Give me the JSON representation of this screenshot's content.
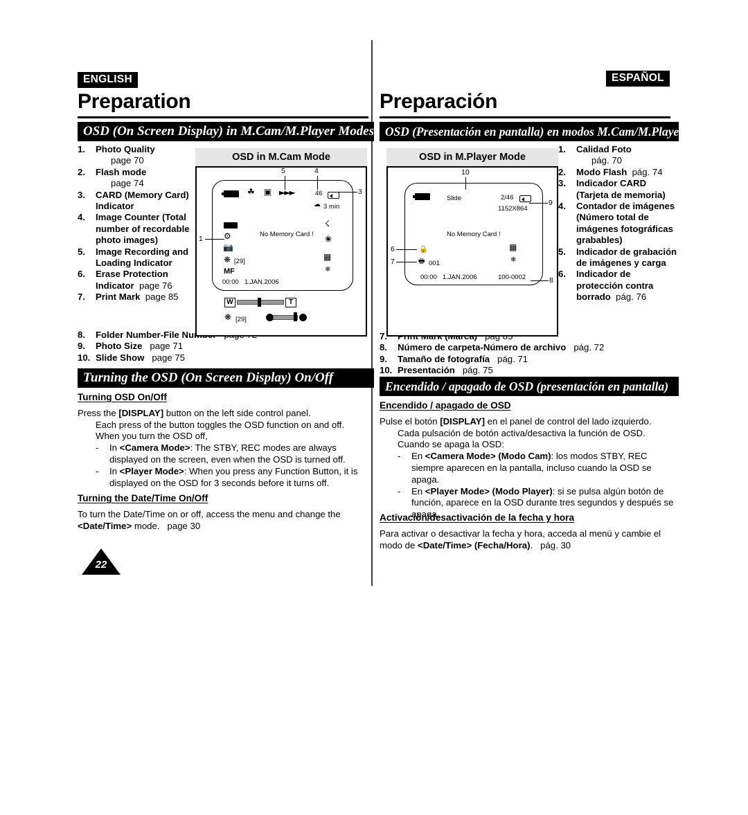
{
  "page": {
    "number": "22"
  },
  "english": {
    "lang_badge": "ENGLISH",
    "title": "Preparation",
    "section_osd_title": "OSD (On Screen Display) in M.Cam/M.Player Modes",
    "section_turn_title": "Turning the OSD (On Screen Display) On/Off",
    "list_items": [
      {
        "n": "1.",
        "label": "Photo Quality",
        "page": "page 70",
        "page_on_new_line": true
      },
      {
        "n": "2.",
        "label": "Flash mode",
        "page": "page 74",
        "page_on_new_line": true
      },
      {
        "n": "3.",
        "label": "CARD (Memory Card) Indicator",
        "page": "",
        "page_on_new_line": false
      },
      {
        "n": "4.",
        "label": "Image Counter (Total number of recordable photo images)",
        "page": "",
        "page_on_new_line": false
      },
      {
        "n": "5.",
        "label": "Image Recording and Loading Indicator",
        "page": "",
        "page_on_new_line": false
      },
      {
        "n": "6.",
        "label": "Erase Protection Indicator",
        "page": "page 76",
        "page_on_new_line": false
      },
      {
        "n": "7.",
        "label": "Print Mark",
        "page": "page 85",
        "page_on_new_line": false
      }
    ],
    "list_items_tail": [
      {
        "n": "8.",
        "label": "Folder Number-File Number",
        "page": "page 72"
      },
      {
        "n": "9.",
        "label": "Photo Size",
        "page": "page 71"
      },
      {
        "n": "10.",
        "label": "Slide Show",
        "page": "page 75"
      }
    ],
    "osd_panel_title": "OSD in M.Cam Mode",
    "sub_head_1": "Turning OSD On/Off",
    "para_1_a": "Press the ",
    "para_1_display": "[DISPLAY]",
    "para_1_b": " button on the left side control panel.",
    "para_1_ind_1": "Each press of the button toggles the OSD function on and off.",
    "para_1_ind_2": "When you turn the OSD off,",
    "bullet_1_dash": "-",
    "bullet_1_pre": "In ",
    "bullet_1_bold": "<Camera Mode>",
    "bullet_1_post": ": The STBY, REC modes are always displayed on the screen, even when the OSD is turned off.",
    "bullet_2_dash": "-",
    "bullet_2_pre": "In ",
    "bullet_2_bold": "<Player Mode>",
    "bullet_2_post": ": When you press any Function Button, it is displayed on the OSD for 3 seconds before it turns off.",
    "sub_head_2": "Turning the Date/Time On/Off",
    "para_2_a": "To turn the Date/Time on or off, access the menu and change the ",
    "para_2_bold": "<Date/Time>",
    "para_2_b": " mode.",
    "para_2_page": "page 30"
  },
  "spanish": {
    "lang_badge": "ESPAÑOL",
    "title": "Preparación",
    "section_osd_title": "OSD (Presentación en pantalla) en modos M.Cam/M.Player",
    "section_turn_title": "Encendido / apagado de OSD (presentación en pantalla)",
    "list_items": [
      {
        "n": "1.",
        "label": "Calidad Foto",
        "page": "pág. 70",
        "page_on_new_line": true
      },
      {
        "n": "2.",
        "label": "Modo Flash",
        "page": "pág. 74",
        "page_on_new_line": false
      },
      {
        "n": "3.",
        "label": "Indicador CARD (Tarjeta de memoria)",
        "page": "",
        "page_on_new_line": false
      },
      {
        "n": "4.",
        "label": "Contador de imágenes (Número total de imágenes fotográficas grabables)",
        "page": "",
        "page_on_new_line": false
      },
      {
        "n": "5.",
        "label": "Indicador de grabación de imágenes y carga",
        "page": "",
        "page_on_new_line": false
      },
      {
        "n": "6.",
        "label": "Indicador de protección contra borrado",
        "page": "pág. 76",
        "page_on_new_line": false
      }
    ],
    "list_items_tail": [
      {
        "n": "7.",
        "label": "Print Mark (Marca)",
        "page": "pág 85"
      },
      {
        "n": "8.",
        "label": "Número de carpeta-Número de archivo",
        "page": "pág. 72"
      },
      {
        "n": "9.",
        "label": "Tamaño de fotografía",
        "page": "pág. 71"
      },
      {
        "n": "10.",
        "label": "Presentación",
        "page": "pág. 75"
      }
    ],
    "osd_panel_title": "OSD in M.Player Mode",
    "sub_head_1": "Encendido / apagado de OSD",
    "para_1_a": "Pulse el botón ",
    "para_1_display": "[DISPLAY]",
    "para_1_b": " en el panel de control del lado izquierdo.",
    "para_1_ind_1": "Cada pulsación de botón activa/desactiva la función de OSD.",
    "para_1_ind_2": "Cuando se apaga la OSD:",
    "bullet_1_dash": "-",
    "bullet_1_pre": "En ",
    "bullet_1_bold": "<Camera Mode> (Modo Cam)",
    "bullet_1_post": ": los modos STBY, REC siempre aparecen en la pantalla, incluso cuando la OSD se apaga.",
    "bullet_2_dash": "-",
    "bullet_2_pre": "En ",
    "bullet_2_bold": "<Player Mode> (Modo Player)",
    "bullet_2_post": ": si se pulsa algún botón de función, aparece en la OSD durante tres segundos y después se apaga.",
    "sub_head_2": "Activación/desactivación de la fecha y hora",
    "para_2_a": "Para activar o desactivar la fecha y hora, acceda al menú y cambie el modo de ",
    "para_2_bold": "<Date/Time> (Fecha/Hora)",
    "para_2_b": ".",
    "para_2_page": "pág. 30"
  },
  "osd_mcam_screen": {
    "callouts": {
      "c1": "1",
      "c3": "3",
      "c4": "4",
      "c5": "5"
    },
    "image_counter": "46",
    "record_time": "3 min",
    "message": "No Memory Card !",
    "aperture_value": "[29]",
    "focus_mode": "MF",
    "timestamp_time": "00:00",
    "timestamp_date": "1.JAN.2006",
    "zoom_w": "W",
    "zoom_t": "T",
    "bottom_aperture": "[29]"
  },
  "osd_mplayer_screen": {
    "callouts": {
      "c6": "6",
      "c7": "7",
      "c8": "8",
      "c9": "9",
      "c10": "10"
    },
    "slide_label": "Slide",
    "image_index": "2/46",
    "photo_size": "1152X864",
    "message": "No Memory Card !",
    "print_count": "001",
    "timestamp_time": "00:00",
    "timestamp_date": "1.JAN.2006",
    "file_number": "100-0002"
  },
  "colors": {
    "bar_bg": "#000000",
    "bar_text": "#ffffff",
    "panel_head_bg": "#e6e6e6",
    "page_bg": "#ffffff"
  }
}
